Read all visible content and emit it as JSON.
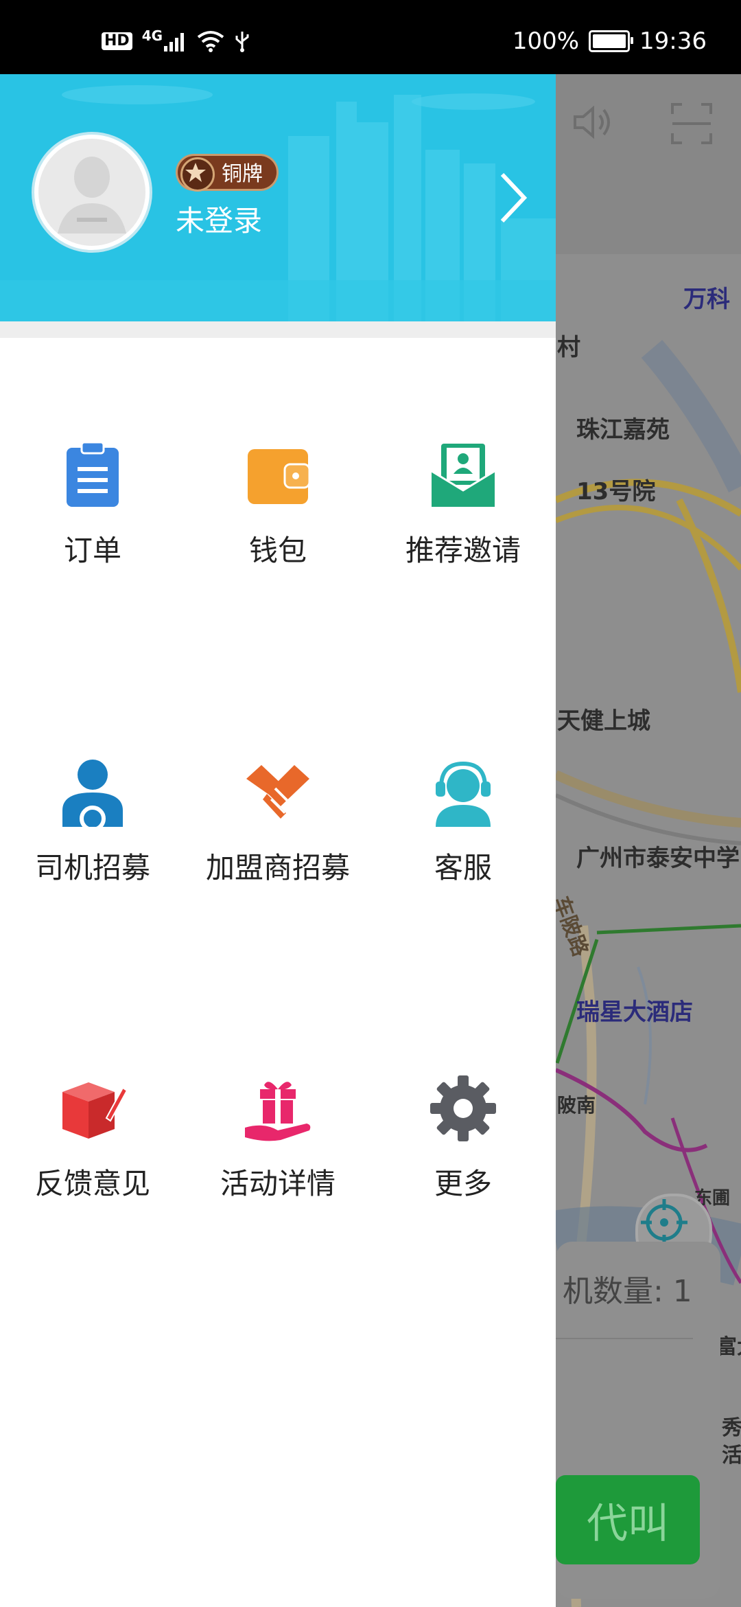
{
  "status_bar": {
    "hd": "HD",
    "network": "4G",
    "battery_percent": "100%",
    "time": "19:36"
  },
  "drawer": {
    "header": {
      "rank_badge": "铜牌",
      "login_status": "未登录",
      "header_color": "#29c3e4"
    },
    "menu": [
      {
        "label": "订单",
        "icon": "clipboard-icon",
        "color": "#3b86e0"
      },
      {
        "label": "钱包",
        "icon": "wallet-icon",
        "color": "#f5a12e"
      },
      {
        "label": "推荐邀请",
        "icon": "invite-envelope-icon",
        "color": "#1fa87a"
      },
      {
        "label": "司机招募",
        "icon": "driver-icon",
        "color": "#1a7fc1"
      },
      {
        "label": "加盟商招募",
        "icon": "handshake-icon",
        "color": "#e8682a"
      },
      {
        "label": "客服",
        "icon": "headset-icon",
        "color": "#2fb6c7"
      },
      {
        "label": "反馈意见",
        "icon": "feedback-box-icon",
        "color": "#e8393a"
      },
      {
        "label": "活动详情",
        "icon": "gift-icon",
        "color": "#e8276b"
      },
      {
        "label": "更多",
        "icon": "gear-icon",
        "color": "#5a5c62"
      }
    ]
  },
  "map": {
    "labels": [
      "万科",
      "村",
      "珠江嘉苑",
      "13号院",
      "天健上城",
      "广州市泰安中学",
      "车陂路",
      "瑞星大酒店",
      "陂南",
      "东圃",
      "富大",
      "秀",
      "活"
    ],
    "driver_count": "机数量:  1",
    "call_button": "代叫"
  }
}
